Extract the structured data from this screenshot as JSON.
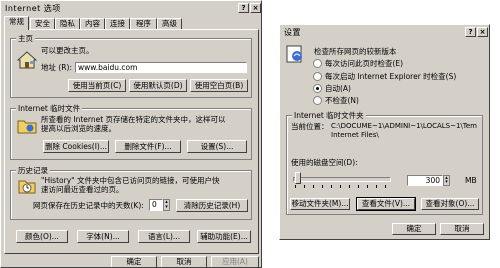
{
  "left_dialog": {
    "title": "Internet 选项",
    "help_glyph": "?",
    "close_glyph": "×",
    "tabs": [
      "常规",
      "安全",
      "隐私",
      "内容",
      "连接",
      "程序",
      "高级"
    ],
    "home": {
      "group_label": "主页",
      "desc": "可以更改主页。",
      "address_label": "地址 (R):",
      "address_value": "www.baidu.com",
      "btn_current": "使用当前页(C)",
      "btn_default": "使用默认页(D)",
      "btn_blank": "使用空白页(B)"
    },
    "temp_files": {
      "group_label": "Internet 临时文件",
      "desc_line1": "所查看的 Internet 页存储在特定的文件夹中，这样可以",
      "desc_line2": "提高以后浏览的速度。",
      "btn_cookies": "删除 Cookies(I)...",
      "btn_files": "删除文件(F)...",
      "btn_settings": "设置(S)..."
    },
    "history": {
      "group_label": "历史记录",
      "desc_line1": "\"History\" 文件夹中包含已访问页的链接，可使用户快",
      "desc_line2": "速访问最近查看过的页。",
      "days_label": "网页保存在历史记录中的天数(K):",
      "days_value": "0",
      "btn_clear": "清除历史记录(H)"
    },
    "bottom_buttons": [
      "颜色(O)...",
      "字体(N)...",
      "语言(L)...",
      "辅助功能(E)..."
    ],
    "footer_buttons": [
      "确定",
      "取消",
      "应用(A)"
    ]
  },
  "right_dialog": {
    "title": "设置",
    "help_glyph": "?",
    "close_glyph": "×",
    "check_label": "检查所存网页的较新版本",
    "options": [
      {
        "label": "每次访问此页时检查(E)",
        "selected": false
      },
      {
        "label": "每次启动 Internet Explorer 时检查(S)",
        "selected": false
      },
      {
        "label": "自动(A)",
        "selected": true
      },
      {
        "label": "不检查(N)",
        "selected": false
      }
    ],
    "group_label": "Internet 临时文件夹",
    "location_label": "当前位置：",
    "location_line1": "C:\\DOCUME~1\\ADMINI~1\\LOCALS~1\\Tem",
    "location_line2": "Internet Files\\",
    "disk_label": "使用的磁盘空间(D):",
    "disk_value": "300",
    "disk_unit": "MB",
    "disk_slider_fraction": 0.02,
    "btn_move": "移动文件夹(M)...",
    "btn_view_files": "查看文件(V)...",
    "btn_view_objects": "查看对象(O)...",
    "btn_ok": "确定",
    "btn_cancel": "取消"
  }
}
